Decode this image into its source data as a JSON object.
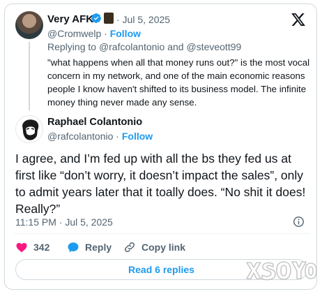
{
  "parent": {
    "name": "Very AFK",
    "date": "· Jul 5, 2025",
    "handle": "@Cromwelp",
    "follow": "Follow",
    "reply_prefix": "Replying to ",
    "reply_to_1": "@rafcolantonio",
    "reply_and": " and ",
    "reply_to_2": "@steveott99",
    "text": "\"what happens when all that money runs out?\" is the most vocal concern in my network, and one of the main economic reasons people I know haven't shifted to its business model. The infinite money thing never made any sense."
  },
  "main": {
    "name": "Raphael Colantonio",
    "handle": "@rafcolantonio",
    "follow": "Follow",
    "text": "I agree, and I’m fed up with all the bs they fed us at first like “don’t worry, it doesn’t impact the sales”, only to admit years later that it toally does. “No shit it does! Really?”",
    "timestamp": "11:15 PM · Jul 5, 2025"
  },
  "actions": {
    "like_count": "342",
    "reply_label": "Reply",
    "copy_label": "Copy link"
  },
  "read_replies": "Read 6 replies",
  "watermark_text": "XSOYO",
  "colors": {
    "accent": "#1d9bf0",
    "like": "#f91880",
    "secondary_text": "#536471",
    "border": "#cfd9de"
  }
}
